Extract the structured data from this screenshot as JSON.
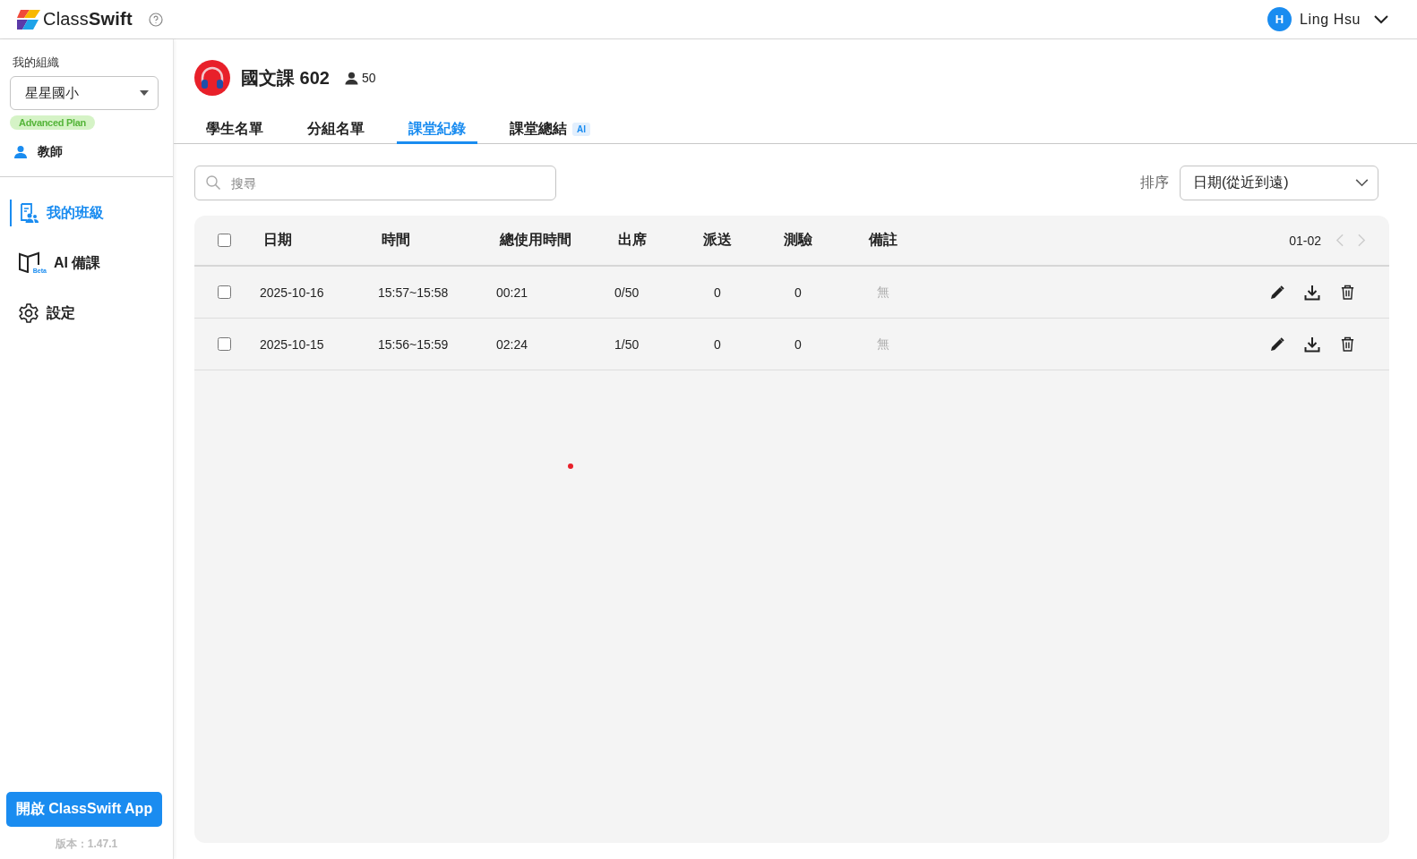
{
  "topbar": {
    "logo": "Class**Swift**",
    "user": {
      "initial": "H",
      "name": "Ling Hsu"
    }
  },
  "sidebar": {
    "org_label": "我的組織",
    "org": "星星國小",
    "plan": "Advanced Plan",
    "role": "教師",
    "nav": [
      {
        "kind": "classes",
        "label": "我的班級",
        "selected": true
      },
      {
        "kind": "ai-prep",
        "label": "AI 備課",
        "badge": "Beta",
        "selected": false
      },
      {
        "kind": "settings",
        "label": "設定",
        "selected": false
      }
    ],
    "app_button": "開啟 ClassSwift App",
    "version": "版本：1.47.1"
  },
  "class": {
    "name": "國文課 602",
    "students": "50"
  },
  "tabs": [
    {
      "label": "學生名單",
      "selected": false
    },
    {
      "label": "分組名單",
      "selected": false
    },
    {
      "label": "課堂紀錄",
      "selected": true
    },
    {
      "label": "課堂總結",
      "badge": "AI",
      "selected": false
    }
  ],
  "search": {
    "placeholder": "搜尋"
  },
  "sort": {
    "label": "排序",
    "value": "日期(從近到遠)"
  },
  "table": {
    "all_checked": false,
    "columns": [
      "日期",
      "時間",
      "總使用時間",
      "出席",
      "派送",
      "測驗",
      "備註"
    ],
    "pager": {
      "range": "01-02",
      "prev_disabled": true,
      "next_disabled": true
    },
    "rows": [
      {
        "checked": false,
        "cells": [
          "2025-10-16",
          "15:57~15:58",
          "00:21",
          "0/50",
          "0",
          "0",
          "無"
        ]
      },
      {
        "checked": false,
        "cells": [
          "2025-10-15",
          "15:56~15:59",
          "02:24",
          "1/50",
          "0",
          "0",
          "無"
        ]
      }
    ]
  }
}
